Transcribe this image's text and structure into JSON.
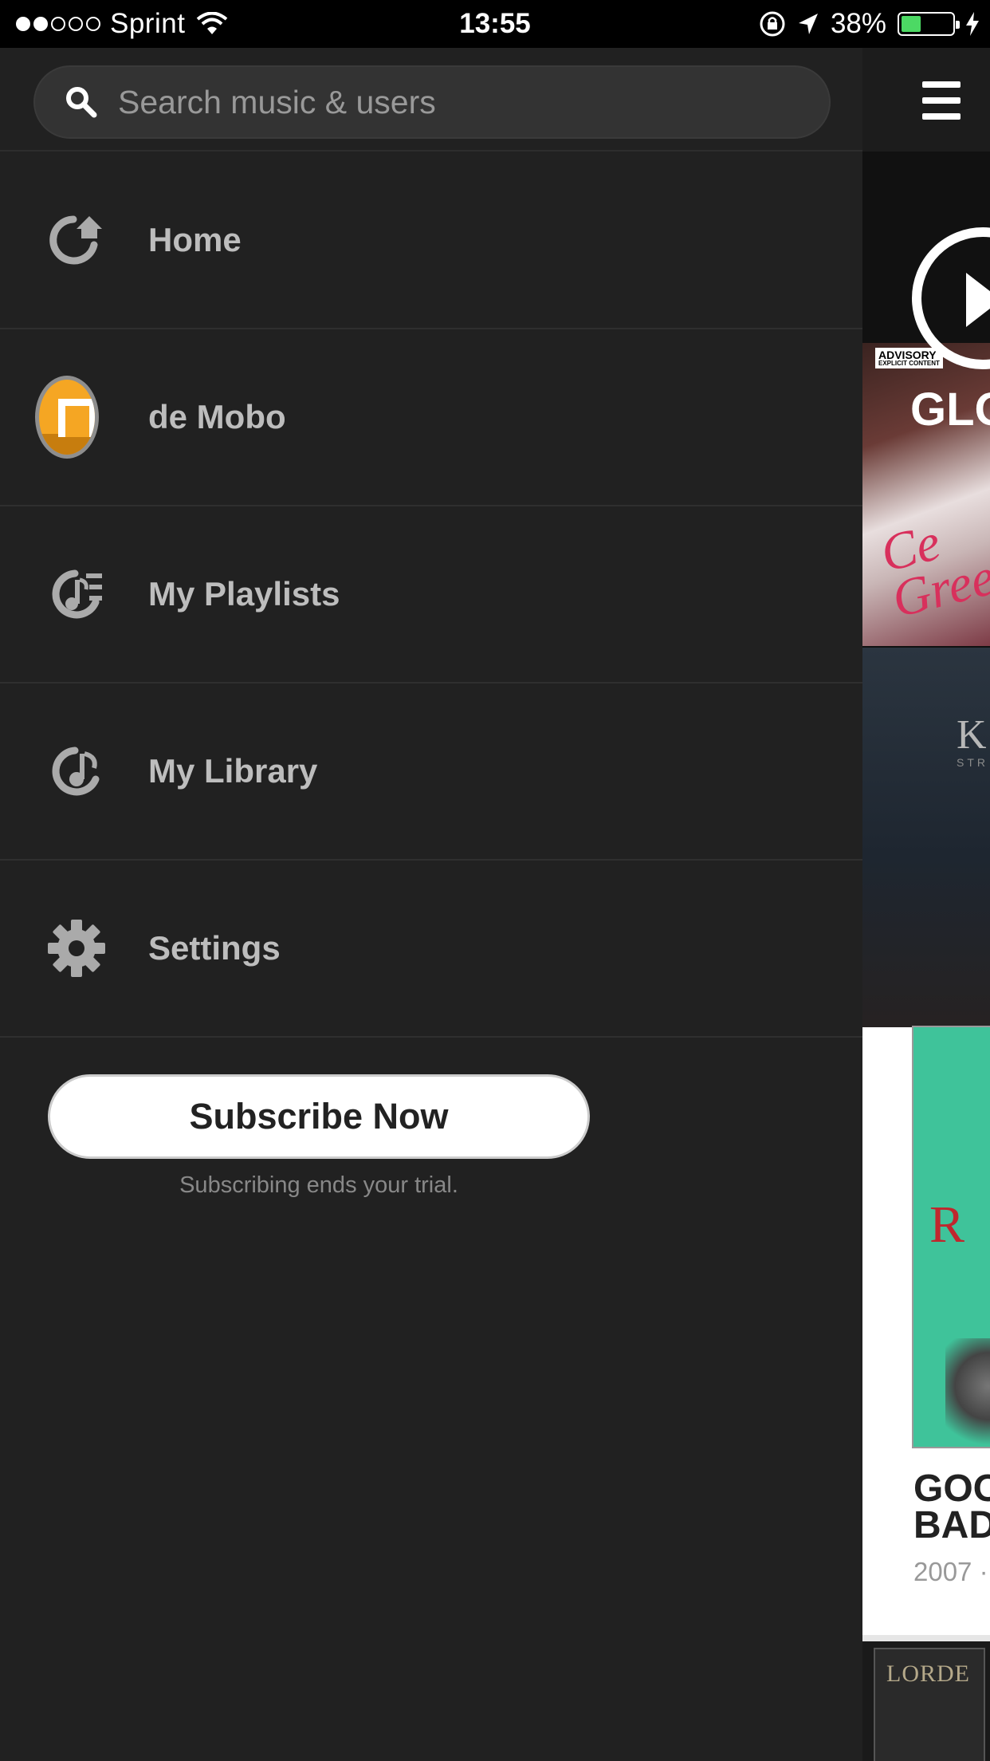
{
  "status_bar": {
    "signal_dots_filled": 2,
    "signal_dots_total": 5,
    "carrier": "Sprint",
    "time": "13:55",
    "battery_percent": "38%",
    "battery_level": 0.38,
    "icons": [
      "wifi-icon",
      "orientation-lock-icon",
      "location-arrow-icon",
      "battery-icon",
      "charging-bolt-icon"
    ]
  },
  "drawer": {
    "search": {
      "placeholder": "Search music & users",
      "value": ""
    },
    "items": [
      {
        "label": "Home",
        "icon": "home-icon"
      },
      {
        "label": "de Mobo",
        "icon": "avatar"
      },
      {
        "label": "My Playlists",
        "icon": "playlist-icon"
      },
      {
        "label": "My Library",
        "icon": "library-icon"
      },
      {
        "label": "Settings",
        "icon": "gear-icon"
      }
    ],
    "subscribe_label": "Subscribe Now",
    "subscribe_note": "Subscribing ends your trial."
  },
  "peek": {
    "menu_icon": "hamburger-icon",
    "album1_badge": "ADVISORY",
    "album1_badge_sub": "EXPLICIT CONTENT",
    "album1_title": "GLO",
    "album1_script": "Ce\nGree",
    "album2_text": "K",
    "album2_sub": "STR",
    "album3_text": "LORDE",
    "card_cover_text": "R",
    "card_title": "GOO\nBAD",
    "card_year": "2007 ·"
  },
  "colors": {
    "drawer_bg": "#212121",
    "accent_orange": "#f5a623",
    "battery_green": "#4cd964"
  }
}
